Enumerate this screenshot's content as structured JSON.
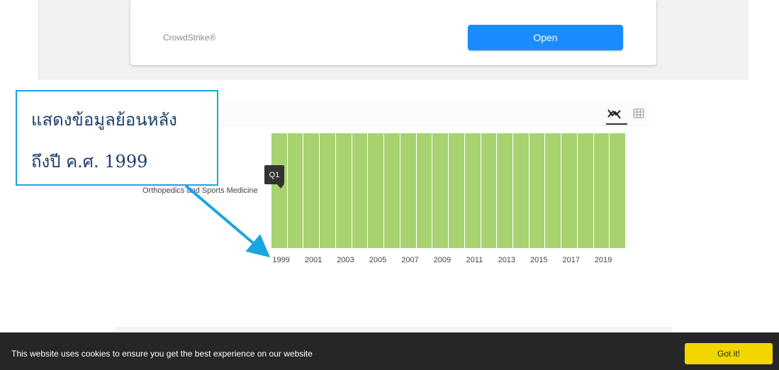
{
  "app_card": {
    "name": "CrowdStrike®",
    "open_label": "Open"
  },
  "chart_tools": {
    "line_icon": "line-chart-icon",
    "table_icon": "table-grid-icon"
  },
  "callout": {
    "line1": "แสดงข้อมูลย้อนหลัง",
    "line2": "ถึงปี ค.ศ. 1999"
  },
  "tooltip": "Q1",
  "colors": {
    "cell": "#a8d26f",
    "accent": "#1a8cff",
    "callout_border": "#19a5e0",
    "cookie_button": "#f1d600"
  },
  "chart_data": {
    "type": "heatmap",
    "rows": [
      "Orthopedics and Sports Medicine"
    ],
    "columns": [
      "1999",
      "2000",
      "2001",
      "2002",
      "2003",
      "2004",
      "2005",
      "2006",
      "2007",
      "2008",
      "2009",
      "2010",
      "2011",
      "2012",
      "2013",
      "2014",
      "2015",
      "2016",
      "2017",
      "2018",
      "2019",
      "2020"
    ],
    "values": [
      [
        "Q1",
        "Q1",
        "Q1",
        "Q1",
        "Q1",
        "Q1",
        "Q1",
        "Q1",
        "Q1",
        "Q1",
        "Q1",
        "Q1",
        "Q1",
        "Q1",
        "Q1",
        "Q1",
        "Q1",
        "Q1",
        "Q1",
        "Q1",
        "Q1",
        "Q1"
      ]
    ],
    "xtick_labels": [
      "1999",
      "2001",
      "2003",
      "2005",
      "2007",
      "2009",
      "2011",
      "2013",
      "2015",
      "2017",
      "2019"
    ]
  },
  "cookie": {
    "text": "This website uses cookies to ensure you get the best experience on our website",
    "button": "Got it!"
  }
}
